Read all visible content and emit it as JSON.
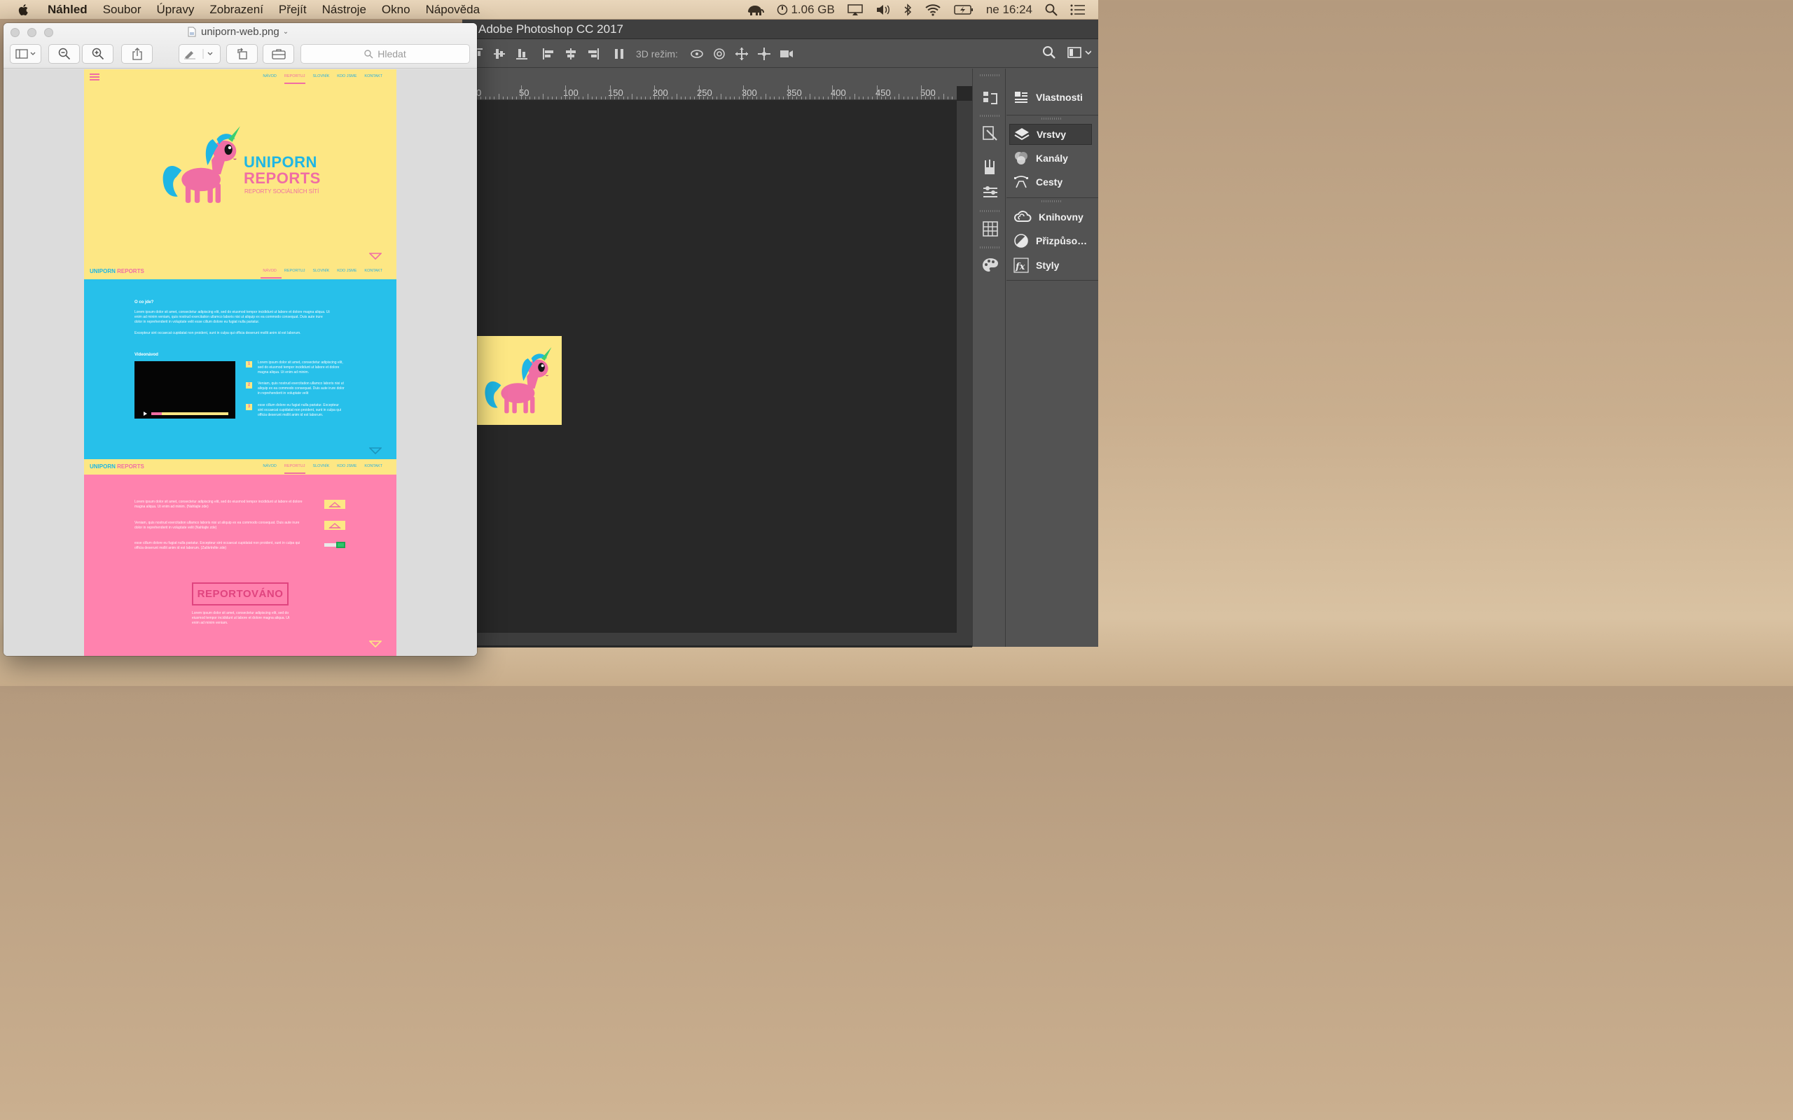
{
  "menubar": {
    "app_name": "Náhled",
    "items": [
      "Soubor",
      "Úpravy",
      "Zobrazení",
      "Přejít",
      "Nástroje",
      "Okno",
      "Nápověda"
    ],
    "memory": "1.06 GB",
    "clock": "ne 16:24"
  },
  "photoshop": {
    "title": "Adobe Photoshop CC 2017",
    "mode_label": "3D režim:",
    "ruler_labels": [
      "0",
      "50",
      "100",
      "150",
      "200",
      "250",
      "300",
      "350",
      "400",
      "450",
      "500"
    ],
    "panels": {
      "properties": "Vlastnosti",
      "layers": "Vrstvy",
      "channels": "Kanály",
      "paths": "Cesty",
      "libraries": "Knihovny",
      "adjustments": "Přizpůso…",
      "styles": "Styly"
    }
  },
  "preview": {
    "filename": "uniporn-web.png",
    "search_placeholder": "Hledat"
  },
  "mockup": {
    "nav_links": [
      "NÁVOD",
      "REPORTUJ",
      "SLOVNÍK",
      "KDO JSME",
      "KONTAKT"
    ],
    "brand_first": "UNIPORN",
    "brand_second": "REPORTS",
    "headline1": "UNIPORN",
    "headline2": "REPORTS",
    "tagline": "REPORTY SOCIÁLNÍCH SÍTÍ",
    "about_heading": "O co jde?",
    "about_p1": "Lorem ipsum dolor sit amet, consectetur adipiscing elit, sed do eiusmod tempor incididunt ut labore et dolore magna aliqua. Ut enim ad minim veniam, quis nostrud exercitation ullamco laboris nisi ut aliquip ex ea commodo consequat. Duis aute irure dolor in reprehenderit in voluptate velit esse cillum dolore eu fugiat nulla pariatur.",
    "about_p2": "Excepteur sint occaecat cupidatat non proident, sunt in culpa qui officia deserunt mollit anim id est laborum.",
    "video_heading": "Videonávod",
    "steps": [
      {
        "num": "1",
        "text": "Lorem ipsum dolor sit amet, consectetur adipiscing elit, sed do eiusmod tempor incididunt ut labore et dolore magna aliqua. Ut enim ad minim."
      },
      {
        "num": "2",
        "text": "Veniam, quis nostrud exercitation ullamco laboris nisi ut aliquip ex ea commodo consequat. Duis aute irure dolor in reprehenderit in voluptate velit"
      },
      {
        "num": "3",
        "text": "esse cillum dolore eu fugiat nulla pariatur. Excepteur sint occaecat cupidatat non proident, sunt in culpa qui officia deserunt mollit anim id est laborum."
      }
    ],
    "report_items": [
      "Lorem ipsum dolor sit amet, consectetur adipiscing elit, sed do eiusmod tempor incididunt ut labore et dolore magna aliqua. Ut enim ad minim. (Nahlajte zde)",
      "Veniam, quis nostrud exercitation ullamco laboris nisi ut aliquip ex ea commodo consequat. Duis aute irure dolor in reprehenderit in voluptate velit (Nahlajte zde)",
      "esse cillum dolore eu fugiat nulla pariatur. Excepteur sint occaecat cupidatat non proident, sunt in culpa qui officia deserunt mollit anim id est laborum. (Zaškrtněte zde)"
    ],
    "reported_label": "REPORTOVÁNO",
    "reported_text": "Lorem ipsum dolor sit amet, consectetur adipiscing elit, sed do eiusmod tempor incididunt ut labore et dolore magna aliqua. Ut enim ad minim veniam.",
    "colors": {
      "yellow": "#fde784",
      "blue": "#27c0ea",
      "pink": "#ff82ae",
      "brand_blue": "#1fb6e4",
      "brand_pink": "#f06ea4"
    }
  }
}
